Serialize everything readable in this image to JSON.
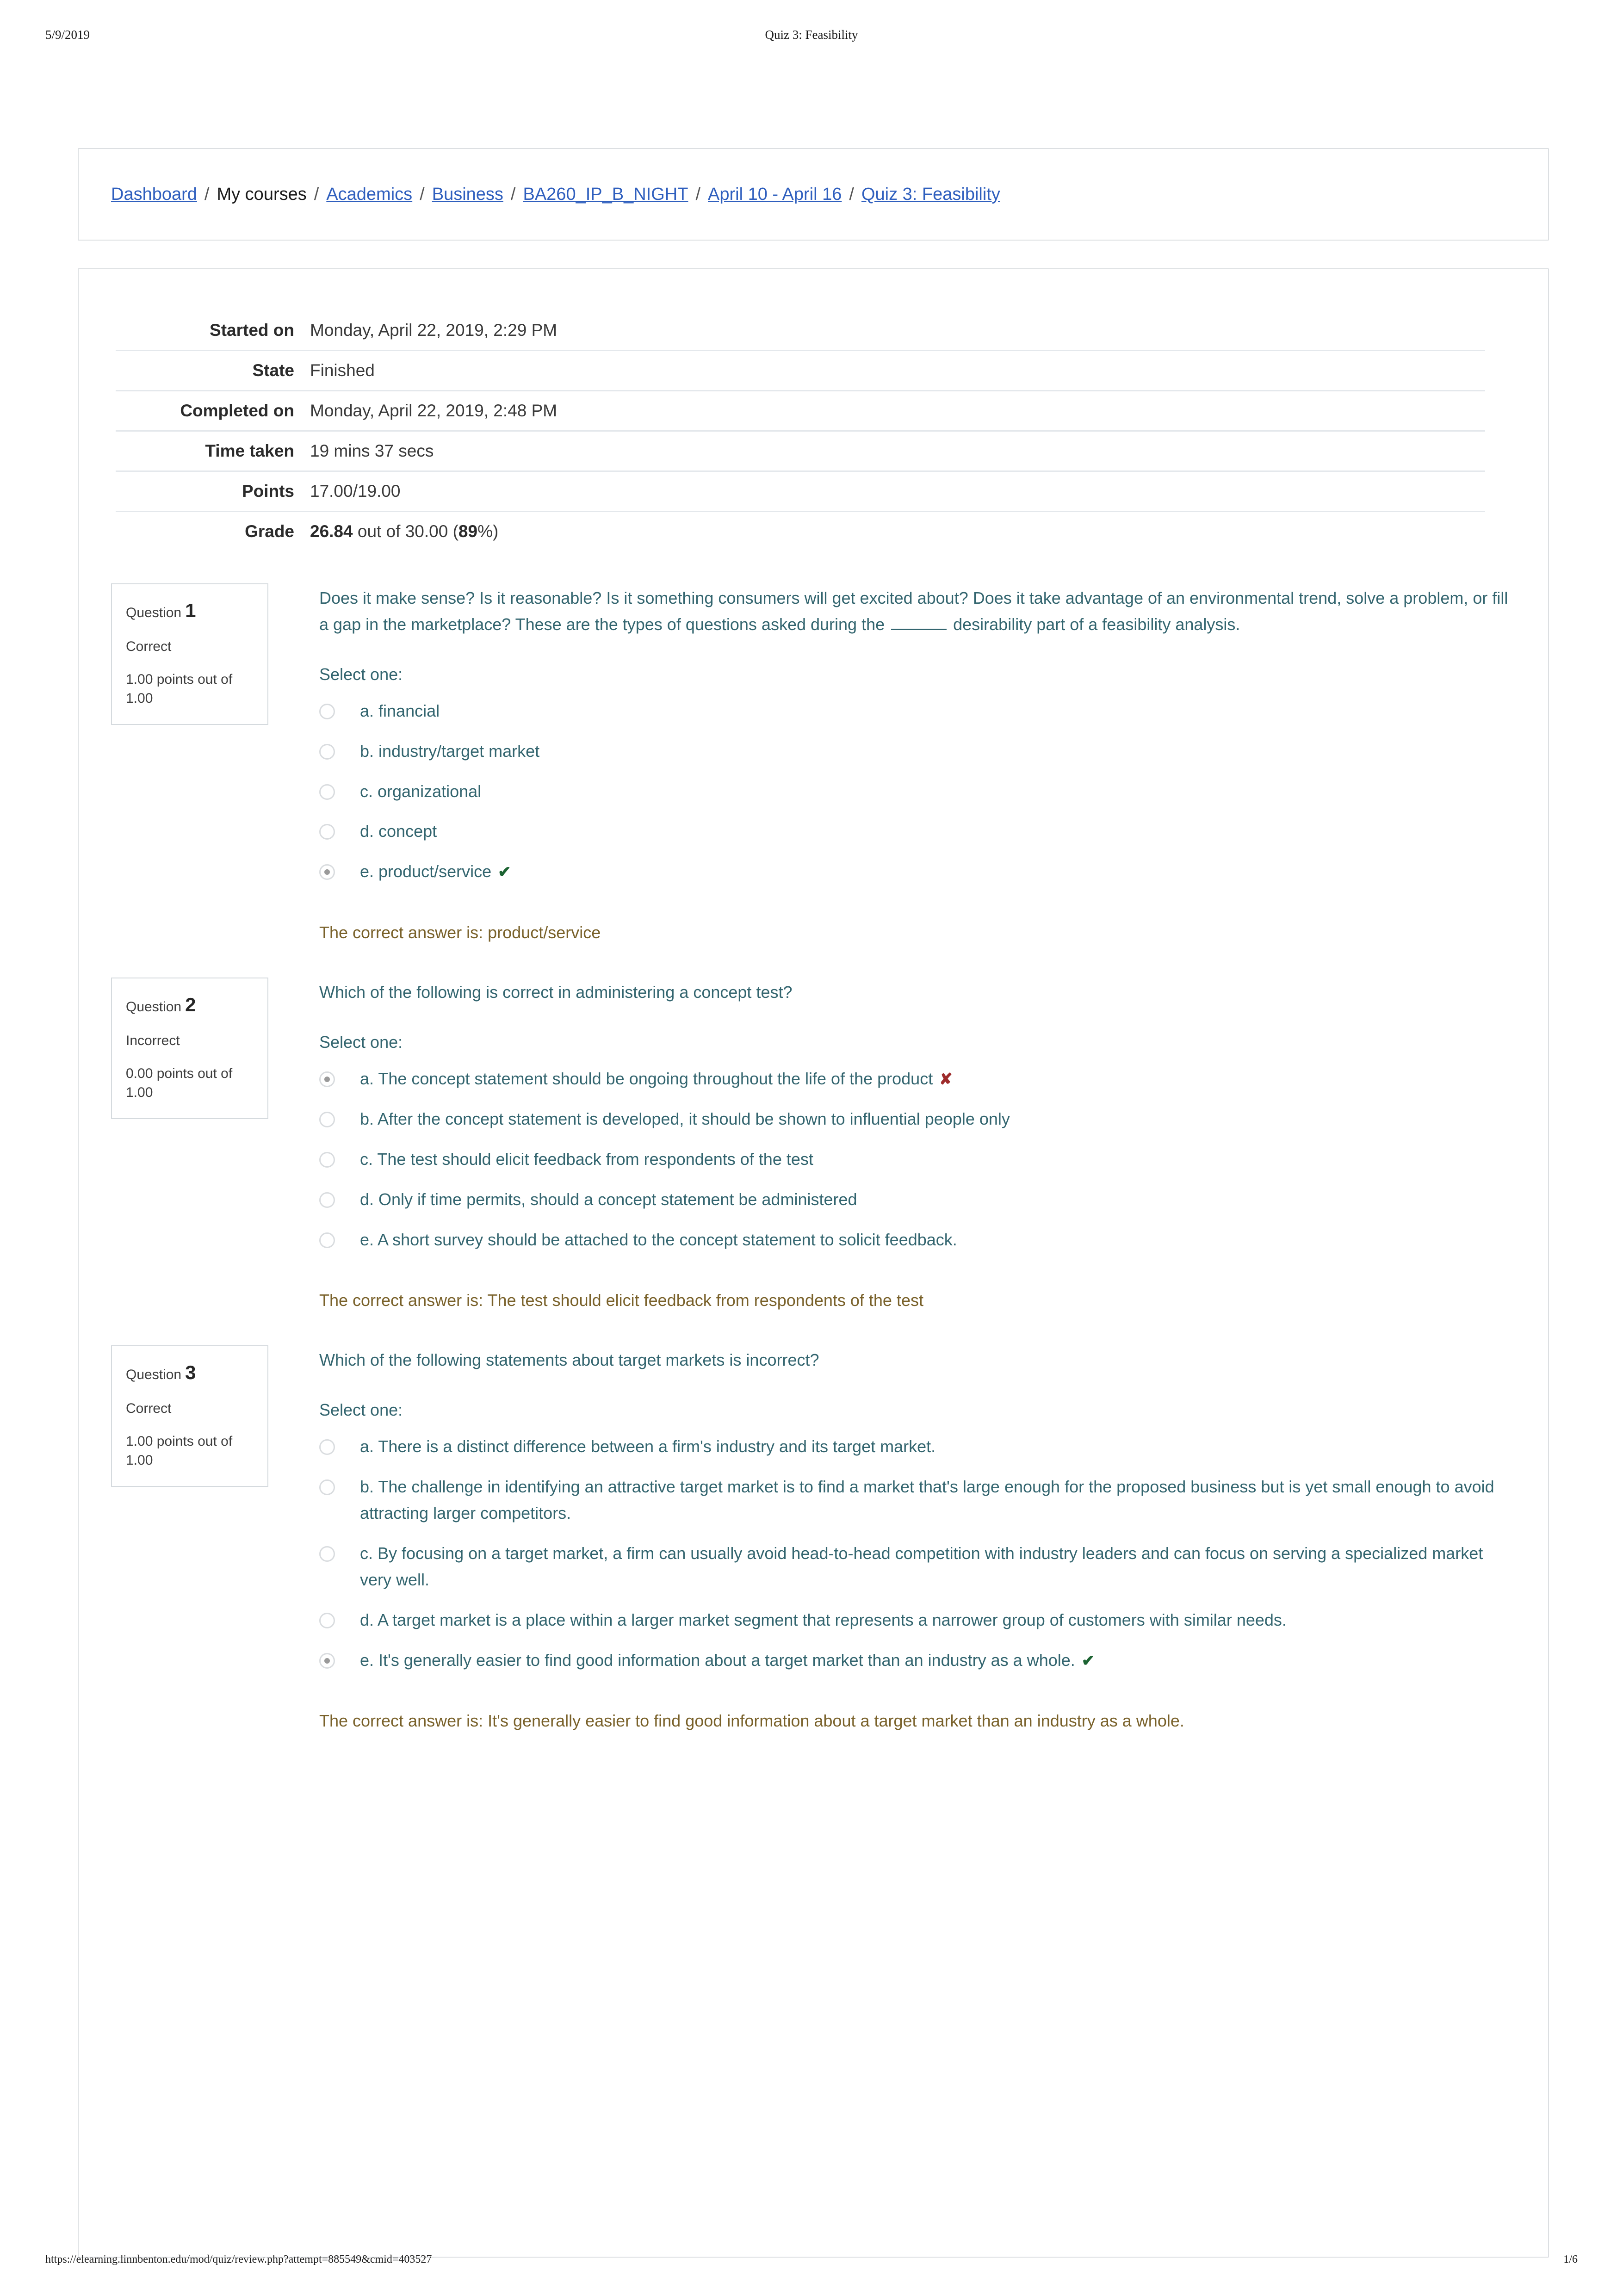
{
  "print_header": {
    "date": "5/9/2019",
    "title": "Quiz 3: Feasibility"
  },
  "breadcrumb": {
    "separator": "/",
    "items": [
      {
        "label": "Dashboard",
        "link": true
      },
      {
        "label": "My courses",
        "link": false
      },
      {
        "label": "Academics",
        "link": true
      },
      {
        "label": "Business",
        "link": true
      },
      {
        "label": "BA260_IP_B_NIGHT",
        "link": true
      },
      {
        "label": "April 10 - April 16",
        "link": true
      },
      {
        "label": "Quiz 3: Feasibility",
        "link": true
      }
    ]
  },
  "summary": {
    "rows": [
      {
        "label": "Started on",
        "value": "Monday, April 22, 2019, 2:29 PM"
      },
      {
        "label": "State",
        "value": "Finished"
      },
      {
        "label": "Completed on",
        "value": "Monday, April 22, 2019, 2:48 PM"
      },
      {
        "label": "Time taken",
        "value": "19 mins 37 secs"
      },
      {
        "label": "Points",
        "value": "17.00/19.00"
      }
    ],
    "grade": {
      "label": "Grade",
      "score": "26.84",
      "middle": " out of 30.00 (",
      "percent": "89",
      "suffix": "%)"
    }
  },
  "labels": {
    "question_word": "Question",
    "select_one": "Select one:",
    "correct_answer_prefix": "The correct answer is: "
  },
  "icons": {
    "correct_mark": "✔",
    "incorrect_mark": "✘"
  },
  "colors": {
    "question_text": "#33656f",
    "link": "#2f5fbe",
    "correct_answer_text": "#79612a",
    "correct_mark": "#1c6332",
    "incorrect_mark": "#9e2b2b",
    "panel_border": "#dcdfe2"
  },
  "questions": [
    {
      "number": "1",
      "state": "Correct",
      "points": "1.00 points out of 1.00",
      "text_before_blank": "Does it make sense? Is it reasonable? Is it something consumers will get excited about? Does it take advantage of an environmental trend, solve a problem, or fill a gap in the marketplace? These are the types of questions asked during the ",
      "text_after_blank": " desirability  part of a  feasibility analysis.",
      "has_blank": true,
      "options": [
        {
          "label": "a. financial",
          "selected": false,
          "mark": ""
        },
        {
          "label": "b. industry/target market",
          "selected": false,
          "mark": ""
        },
        {
          "label": "c. organizational",
          "selected": false,
          "mark": ""
        },
        {
          "label": "d. concept",
          "selected": false,
          "mark": ""
        },
        {
          "label": "e. product/service",
          "selected": true,
          "mark": "correct"
        }
      ],
      "correct_answer": "product/service"
    },
    {
      "number": "2",
      "state": "Incorrect",
      "points": "0.00 points out of 1.00",
      "text_before_blank": "Which of the following is correct in administering a concept test?",
      "text_after_blank": "",
      "has_blank": false,
      "options": [
        {
          "label": "a. The concept statement should be ongoing throughout the life of the product",
          "selected": true,
          "mark": "incorrect"
        },
        {
          "label": "b. After the concept statement is developed, it should be shown to influential people only",
          "selected": false,
          "mark": ""
        },
        {
          "label": "c. The test should elicit feedback from respondents of the test",
          "selected": false,
          "mark": ""
        },
        {
          "label": "d. Only if time permits, should a concept statement be administered",
          "selected": false,
          "mark": ""
        },
        {
          "label": "e. A short survey should be attached to the concept statement to solicit feedback.",
          "selected": false,
          "mark": ""
        }
      ],
      "correct_answer": "The test should elicit feedback from respondents of the test"
    },
    {
      "number": "3",
      "state": "Correct",
      "points": "1.00 points out of 1.00",
      "text_before_blank": "Which of the following statements about target markets is incorrect?",
      "text_after_blank": "",
      "has_blank": false,
      "options": [
        {
          "label": "a. There is a distinct difference between a firm's industry and its target market.",
          "selected": false,
          "mark": ""
        },
        {
          "label": "b. The challenge in identifying an attractive target market is to find a market that's large enough for the proposed business but is yet small enough to avoid attracting larger competitors.",
          "selected": false,
          "mark": ""
        },
        {
          "label": "c. By focusing on a target market, a firm can usually avoid head-to-head competition with industry leaders and can focus on serving a specialized market very well.",
          "selected": false,
          "mark": ""
        },
        {
          "label": "d. A target market is a place within a larger market segment that represents a narrower group of customers with similar needs.",
          "selected": false,
          "mark": ""
        },
        {
          "label": "e. It's generally easier to find good information about a target market than an industry as a whole.",
          "selected": true,
          "mark": "correct"
        }
      ],
      "correct_answer": "It's generally easier to find good information about a target market than an industry as a whole."
    }
  ],
  "print_footer": {
    "url": "https://elearning.linnbenton.edu/mod/quiz/review.php?attempt=885549&cmid=403527",
    "page": "1/6"
  }
}
